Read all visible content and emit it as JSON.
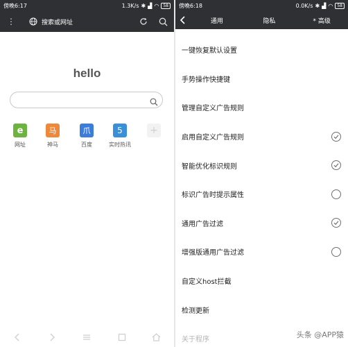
{
  "left": {
    "status": {
      "time": "傍晚6:17",
      "speed": "1.3K/s",
      "battery": "58"
    },
    "toolbar": {
      "menu_icon": "more-vert-icon",
      "url_placeholder": "搜索或网址"
    },
    "hello": "hello",
    "quick_links": [
      {
        "label": "网址",
        "color": "#6db33f",
        "glyph": "e"
      },
      {
        "label": "神马",
        "color": "#f0883a",
        "glyph": "马"
      },
      {
        "label": "百度",
        "color": "#3b7ddd",
        "glyph": "爪"
      },
      {
        "label": "实时热讯",
        "color": "#3a8fd9",
        "glyph": "5"
      }
    ]
  },
  "right": {
    "status": {
      "time": "傍晚6:18",
      "speed": "0.0K/s",
      "battery": "58"
    },
    "tabs": [
      "通用",
      "隐私",
      "* 高级"
    ],
    "settings": [
      {
        "label": "一键恢复默认设置",
        "checked": null
      },
      {
        "label": "手势操作快捷键",
        "checked": null
      },
      {
        "label": "管理自定义广告规则",
        "checked": null
      },
      {
        "label": "启用自定义广告规则",
        "checked": true
      },
      {
        "label": "智能优化标识规则",
        "checked": true
      },
      {
        "label": "标识广告时提示属性",
        "checked": false
      },
      {
        "label": "通用广告过滤",
        "checked": true
      },
      {
        "label": "增强版通用广告过滤",
        "checked": false
      },
      {
        "label": "自定义host拦截",
        "checked": null
      },
      {
        "label": "检测更新",
        "checked": null
      },
      {
        "label": "关于程序",
        "checked": null,
        "dim": true
      }
    ],
    "watermark": "头条 @APP猿"
  },
  "colors": {
    "toolbar": "#2f3033",
    "check": "#6f6f6f"
  }
}
